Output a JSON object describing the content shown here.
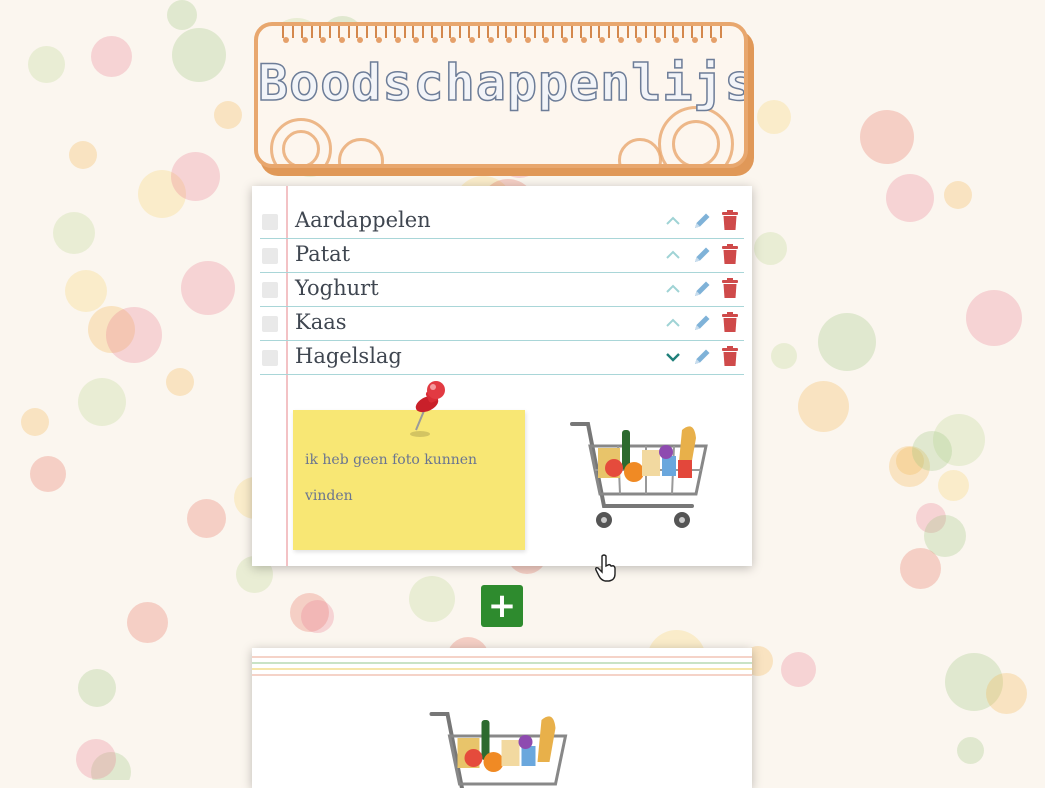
{
  "header": {
    "title": "Boodschappenlijst"
  },
  "list": {
    "items": [
      {
        "name": "Aardappelen",
        "expanded": false
      },
      {
        "name": "Patat",
        "expanded": false
      },
      {
        "name": "Yoghurt",
        "expanded": false
      },
      {
        "name": "Kaas",
        "expanded": false
      },
      {
        "name": "Hagelslag",
        "expanded": true
      }
    ],
    "note": "ik heb geen foto kunnen vinden"
  },
  "actions": {
    "add_label": "+"
  },
  "colors": {
    "accent_green": "#2e8b2e",
    "trash_red": "#cf4a4a",
    "pencil_blue": "#7fb2d8",
    "chevron_teal": "#1f7f7a",
    "title_border": "#e8a76e",
    "sticky_yellow": "#f8e774"
  },
  "icons": [
    "chevron-up-icon",
    "chevron-down-icon",
    "pencil-icon",
    "trash-icon",
    "pushpin-icon",
    "shopping-cart-icon",
    "hand-cursor-icon"
  ]
}
